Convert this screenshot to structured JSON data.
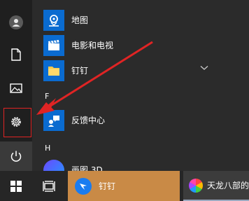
{
  "start_menu": {
    "apps": [
      {
        "label": "地图",
        "icon": "map-icon"
      },
      {
        "label": "电影和电视",
        "icon": "movies-tv-icon"
      },
      {
        "label": "钉钉",
        "icon": "folder-icon"
      },
      {
        "label": "反馈中心",
        "icon": "feedback-hub-icon"
      },
      {
        "label": "画图 3D",
        "icon": "paint-3d-icon"
      }
    ],
    "sections": {
      "f": "F",
      "h": "H"
    }
  },
  "rail": {
    "items": [
      "user-icon",
      "documents-icon",
      "pictures-icon",
      "settings-icon",
      "power-icon"
    ],
    "highlight_color": "#e02424"
  },
  "taskbar": {
    "app1_label": "钉钉",
    "app2_label": "天龙八部的"
  },
  "annotation": {
    "arrow_color": "#e02424"
  },
  "colors": {
    "accent": "#0a6bd0",
    "taskbar_active": "#c98a46"
  }
}
